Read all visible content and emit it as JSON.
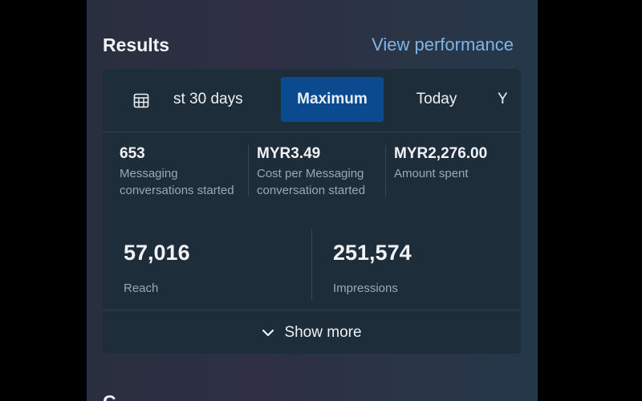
{
  "header": {
    "title": "Results",
    "link": "View performance"
  },
  "date_tabs": [
    {
      "label": "st 30 days",
      "selected": false
    },
    {
      "label": "Maximum",
      "selected": true
    },
    {
      "label": "Today",
      "selected": false
    },
    {
      "label": "Y",
      "selected": false
    }
  ],
  "metrics": [
    {
      "value": "653",
      "label_line1": "Messaging",
      "label_line2": "conversations started"
    },
    {
      "value": "MYR3.49",
      "label_line1": "Cost per Messaging",
      "label_line2": "conversation started"
    },
    {
      "value": "MYR2,276.00",
      "label_line1": "Amount spent",
      "label_line2": ""
    }
  ],
  "big_metrics": [
    {
      "value": "57,016",
      "label": "Reach"
    },
    {
      "value": "251,574",
      "label": "Impressions"
    }
  ],
  "footer": {
    "label": "Show more"
  },
  "bottom_partial_title": "C",
  "colors": {
    "accent": "#0c4a8f",
    "link": "#7fb4e8",
    "card_bg": "#1e2d3a"
  },
  "icons": {
    "calendar": "calendar-icon",
    "chevron": "chevron-down-icon"
  }
}
